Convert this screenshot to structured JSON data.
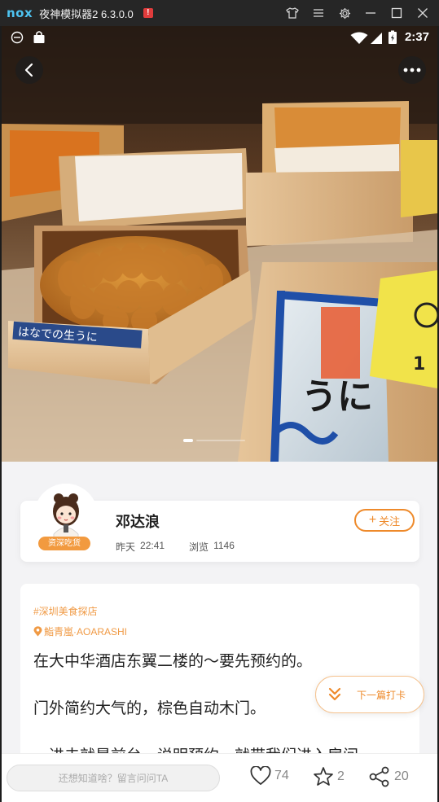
{
  "emulator": {
    "logo": "nox",
    "title": "夜神模拟器2 6.3.0.0",
    "warning": "!",
    "controls": [
      "shirt-icon",
      "menu-icon",
      "gear-icon",
      "minimize-icon",
      "maximize-icon",
      "close-icon"
    ]
  },
  "status_bar": {
    "time": "2:37"
  },
  "hero": {
    "box_label": "はなでの生うに",
    "sign_text": "うに",
    "tag_number": "1",
    "page_indicator_active": 0
  },
  "author": {
    "name": "邓达浪",
    "badge": "资深吃货",
    "time_label": "昨天",
    "time_value": "22:41",
    "views_label": "浏览",
    "views_count": "1146",
    "follow_label": "关注"
  },
  "post": {
    "topic_tag": "#深圳美食探店",
    "location": "鮨青嵐·AOARASHI",
    "paragraphs": [
      "在大中华酒店东翼二楼的～要先预约的。",
      "门外简约大气的，棕色自动木门。",
      "一进去就是前台，说明预约，就带我们进入房间"
    ]
  },
  "next_button": {
    "label": "下一篇打卡"
  },
  "bottom_bar": {
    "comment_placeholder": "还想知道啥？留言问问TA",
    "like_count": "74",
    "collect_count": "2",
    "share_count": "20"
  },
  "colors": {
    "accent": "#ee8a2b",
    "tag": "#f09a45",
    "badge": "#f29a3f"
  }
}
